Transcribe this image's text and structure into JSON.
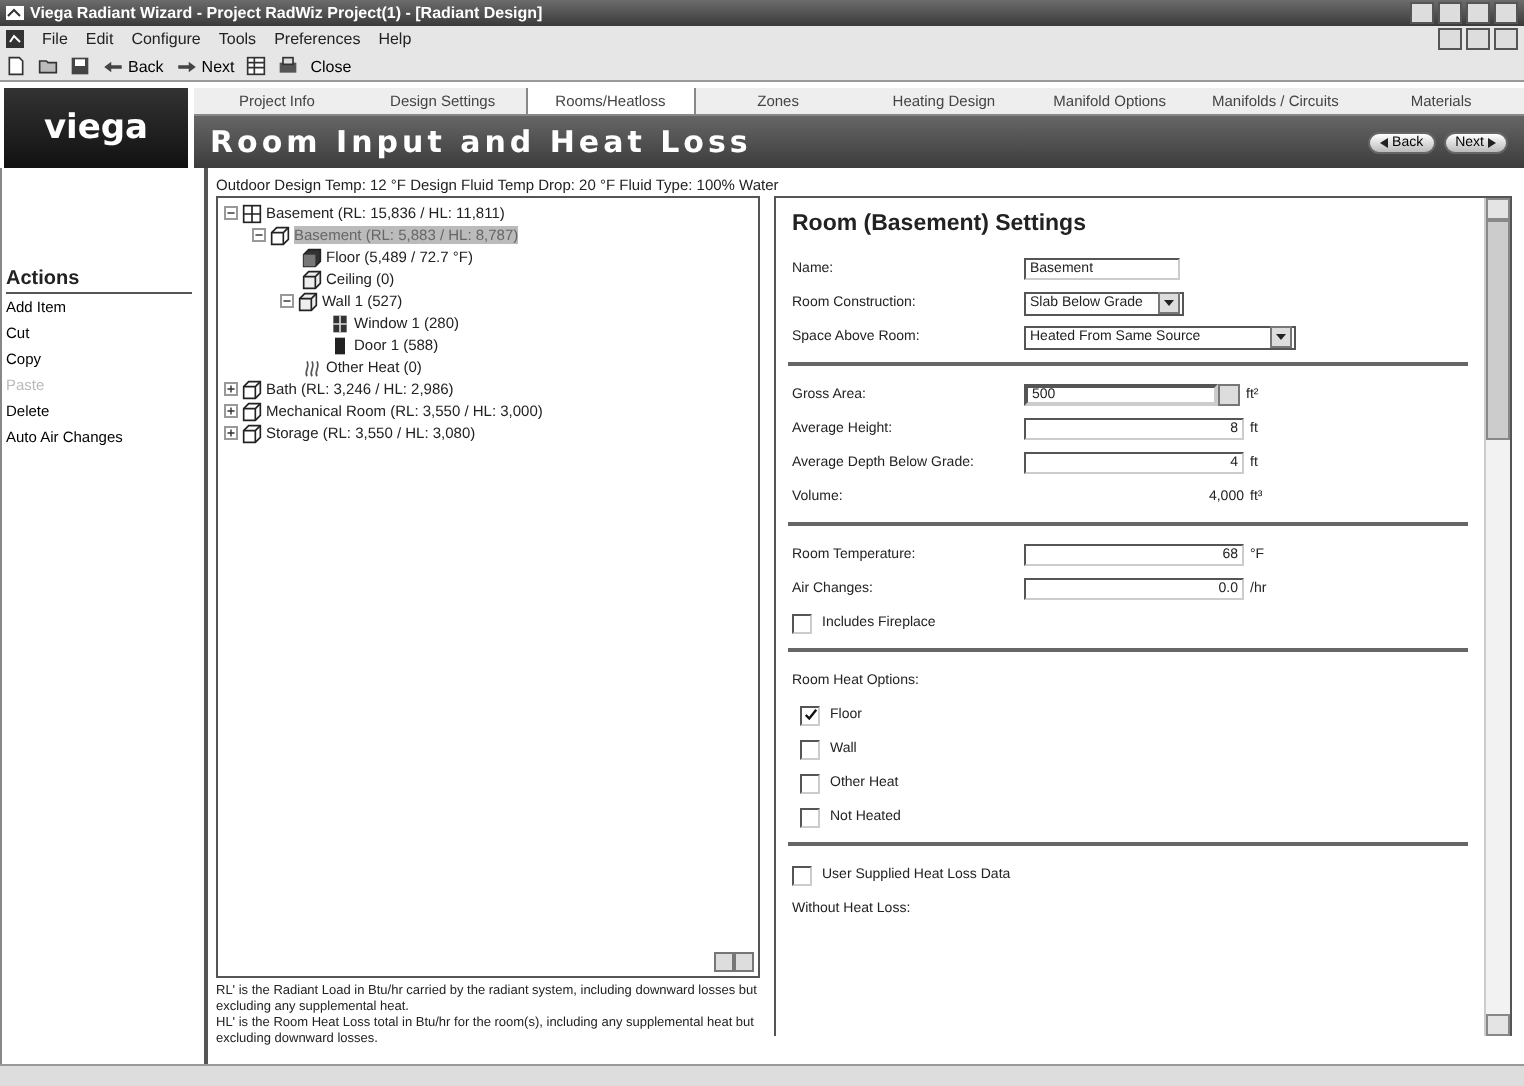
{
  "window": {
    "title": "Viega Radiant Wizard - Project RadWiz Project(1) - [Radiant Design]"
  },
  "menu": [
    "File",
    "Edit",
    "Configure",
    "Tools",
    "Preferences",
    "Help"
  ],
  "toolbar": [
    {
      "kind": "new"
    },
    {
      "kind": "open"
    },
    {
      "kind": "save"
    },
    {
      "kind": "back",
      "label": "Back"
    },
    {
      "kind": "next",
      "label": "Next"
    },
    {
      "kind": "sheet"
    },
    {
      "kind": "print"
    },
    {
      "kind": "close",
      "label": "Close"
    }
  ],
  "logo": "viega",
  "tabs": [
    {
      "label": "Project Info",
      "selected": false
    },
    {
      "label": "Design Settings",
      "selected": false
    },
    {
      "label": "Rooms/Heatloss",
      "selected": true
    },
    {
      "label": "Zones",
      "selected": false
    },
    {
      "label": "Heating Design",
      "selected": false
    },
    {
      "label": "Manifold Options",
      "selected": false
    },
    {
      "label": "Manifolds / Circuits",
      "selected": false
    },
    {
      "label": "Materials",
      "selected": false
    }
  ],
  "header": {
    "title": "Room Input and Heat Loss",
    "back": "Back",
    "next": "Next"
  },
  "actions": {
    "title": "Actions",
    "items": [
      {
        "label": "Add Item",
        "disabled": false
      },
      {
        "label": "Cut",
        "disabled": false
      },
      {
        "label": "Copy",
        "disabled": false
      },
      {
        "label": "Paste",
        "disabled": true
      },
      {
        "label": "Delete",
        "disabled": false
      },
      {
        "label": "Auto Air Changes",
        "disabled": false
      }
    ]
  },
  "info_line": "Outdoor Design Temp:  12 °F    Design Fluid Temp Drop:  20 °F    Fluid Type:  100% Water",
  "tree": [
    {
      "kind": "building",
      "label": "Basement (RL: 15,836 / HL: 11,811)",
      "expanded": true,
      "selected": false,
      "children": [
        {
          "kind": "room",
          "label": "Basement (RL: 5,883 / HL: 8,787)",
          "expanded": true,
          "selected": true,
          "children": [
            {
              "kind": "floor",
              "label": "Floor (5,489 / 72.7 °F)",
              "selected": false
            },
            {
              "kind": "surface",
              "label": "Ceiling (0)",
              "selected": false
            },
            {
              "kind": "surface",
              "label": "Wall 1 (527)",
              "expanded": true,
              "selected": false,
              "children": [
                {
                  "kind": "window",
                  "label": "Window 1 (280)",
                  "selected": false
                },
                {
                  "kind": "door",
                  "label": "Door 1 (588)",
                  "selected": false
                }
              ]
            },
            {
              "kind": "heat",
              "label": "Other Heat (0)",
              "selected": false
            }
          ]
        }
      ]
    },
    {
      "kind": "room",
      "label": "Bath (RL: 3,246 / HL: 2,986)",
      "expanded": false,
      "selected": false
    },
    {
      "kind": "room",
      "label": "Mechanical Room (RL: 3,550 / HL: 3,000)",
      "expanded": false,
      "selected": false
    },
    {
      "kind": "room",
      "label": "Storage (RL: 3,550 / HL: 3,080)",
      "expanded": false,
      "selected": false
    }
  ],
  "notes": [
    "RL' is the Radiant Load in Btu/hr carried by the radiant system, including downward losses but excluding any supplemental heat.",
    "HL' is the Room Heat Loss total in Btu/hr for the room(s), including any supplemental heat but excluding downward losses."
  ],
  "settings": {
    "title": "Room (Basement) Settings",
    "sections": [
      [
        {
          "kind": "text",
          "label": "Name:",
          "value": "Basement"
        },
        {
          "kind": "select",
          "label": "Room Construction:",
          "value": "Slab Below Grade"
        },
        {
          "kind": "select-wide",
          "label": "Space Above Room:",
          "value": "Heated From Same Source"
        }
      ],
      [
        {
          "kind": "area",
          "label": "Gross Area:",
          "value": "500",
          "unit": "ft²"
        },
        {
          "kind": "number",
          "label": "Average Height:",
          "value": "8",
          "unit": "ft"
        },
        {
          "kind": "number",
          "label": "Average Depth Below Grade:",
          "value": "4",
          "unit": "ft"
        },
        {
          "kind": "static",
          "label": "Volume:",
          "value": "4,000",
          "unit": "ft³"
        }
      ],
      [
        {
          "kind": "number",
          "label": "Room Temperature:",
          "value": "68",
          "unit": "°F"
        },
        {
          "kind": "number",
          "label": "Air Changes:",
          "value": "0.0",
          "unit": "/hr"
        },
        {
          "kind": "checkbox",
          "label": "Includes Fireplace",
          "checked": false
        }
      ],
      [
        {
          "kind": "heading",
          "label": "Room Heat Options:"
        },
        {
          "kind": "checkbox",
          "label": "Floor",
          "checked": true
        },
        {
          "kind": "checkbox",
          "label": "Wall",
          "checked": false
        },
        {
          "kind": "checkbox",
          "label": "Other Heat",
          "checked": false
        },
        {
          "kind": "checkbox",
          "label": "Not Heated",
          "checked": false
        }
      ],
      [
        {
          "kind": "checkbox",
          "label": "User Supplied Heat Loss Data",
          "checked": false
        },
        {
          "kind": "heading",
          "label": "Without Heat Loss:"
        }
      ]
    ]
  }
}
